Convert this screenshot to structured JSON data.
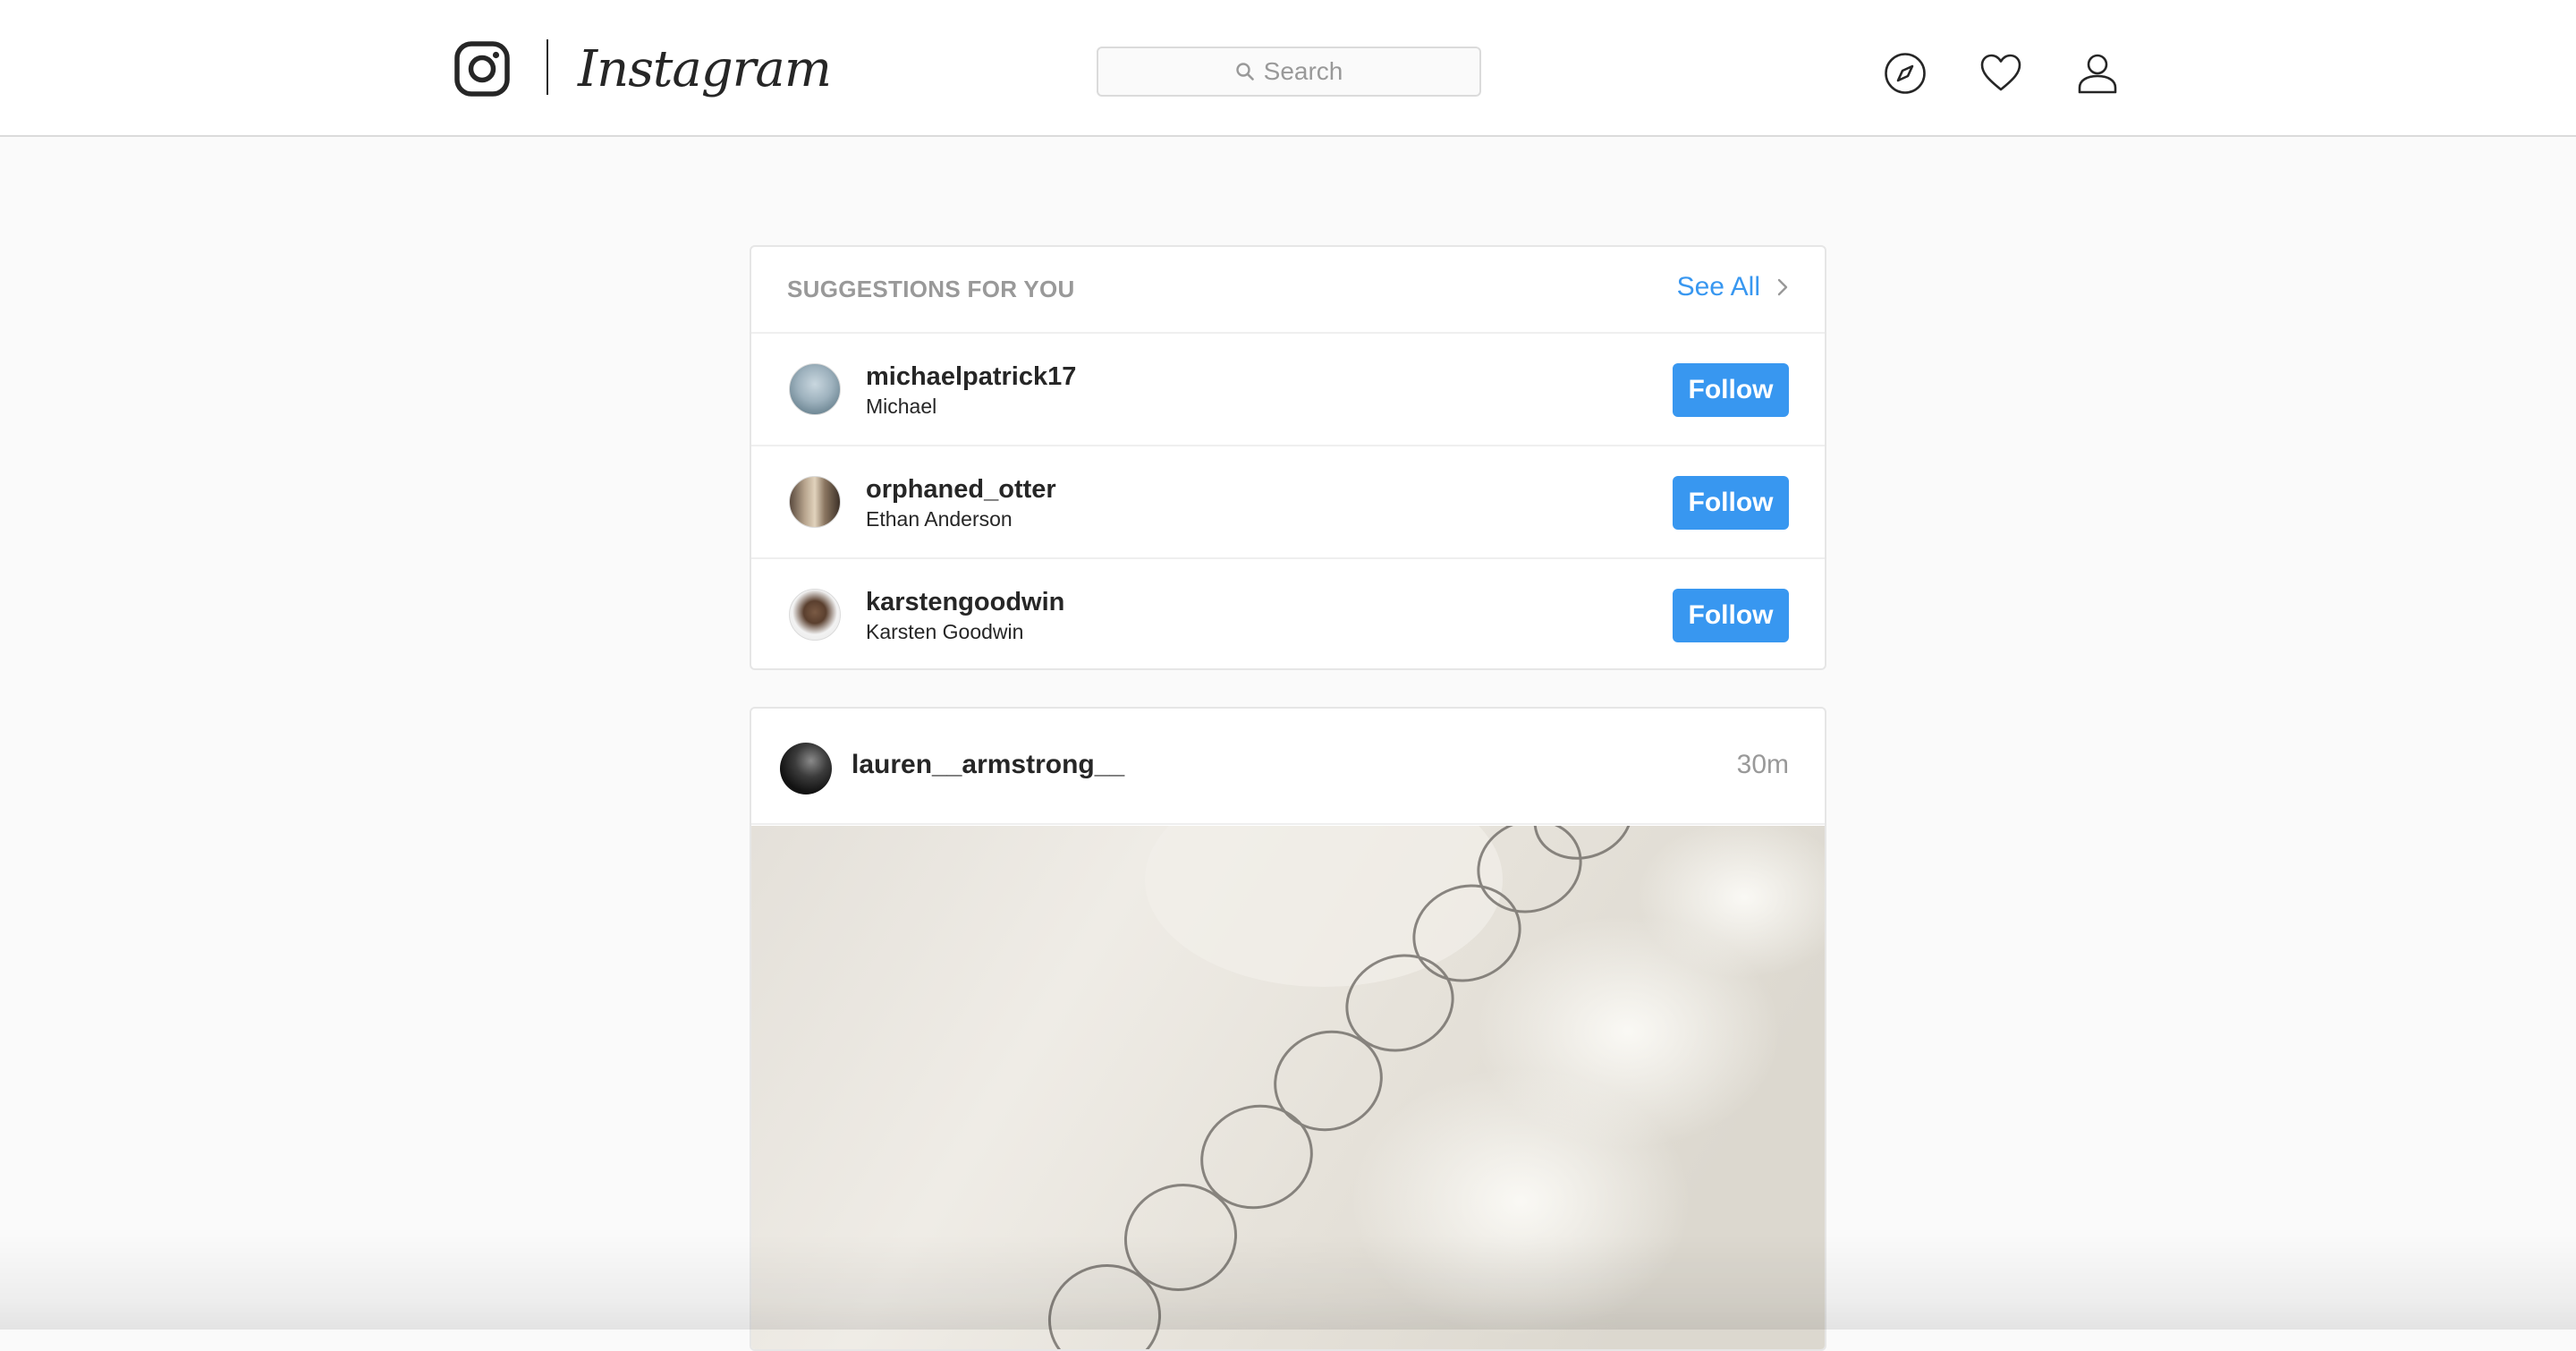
{
  "header": {
    "logo_text": "Instagram",
    "search": {
      "placeholder": "Search"
    },
    "icons": [
      "instagram-glyph-icon",
      "compass-icon",
      "heart-icon",
      "person-icon"
    ]
  },
  "suggestions": {
    "title": "SUGGESTIONS FOR YOU",
    "see_all_label": "See All",
    "items": [
      {
        "username": "michaelpatrick17",
        "full_name": "Michael",
        "follow_label": "Follow"
      },
      {
        "username": "orphaned_otter",
        "full_name": "Ethan Anderson",
        "follow_label": "Follow"
      },
      {
        "username": "karstengoodwin",
        "full_name": "Karsten Goodwin",
        "follow_label": "Follow"
      }
    ]
  },
  "post": {
    "username": "lauren__armstrong__",
    "time": "30m"
  },
  "colors": {
    "accent": "#3897f0",
    "background": "#fafafa",
    "border": "#dbdbdb",
    "muted_text": "#999999",
    "text": "#262626"
  }
}
